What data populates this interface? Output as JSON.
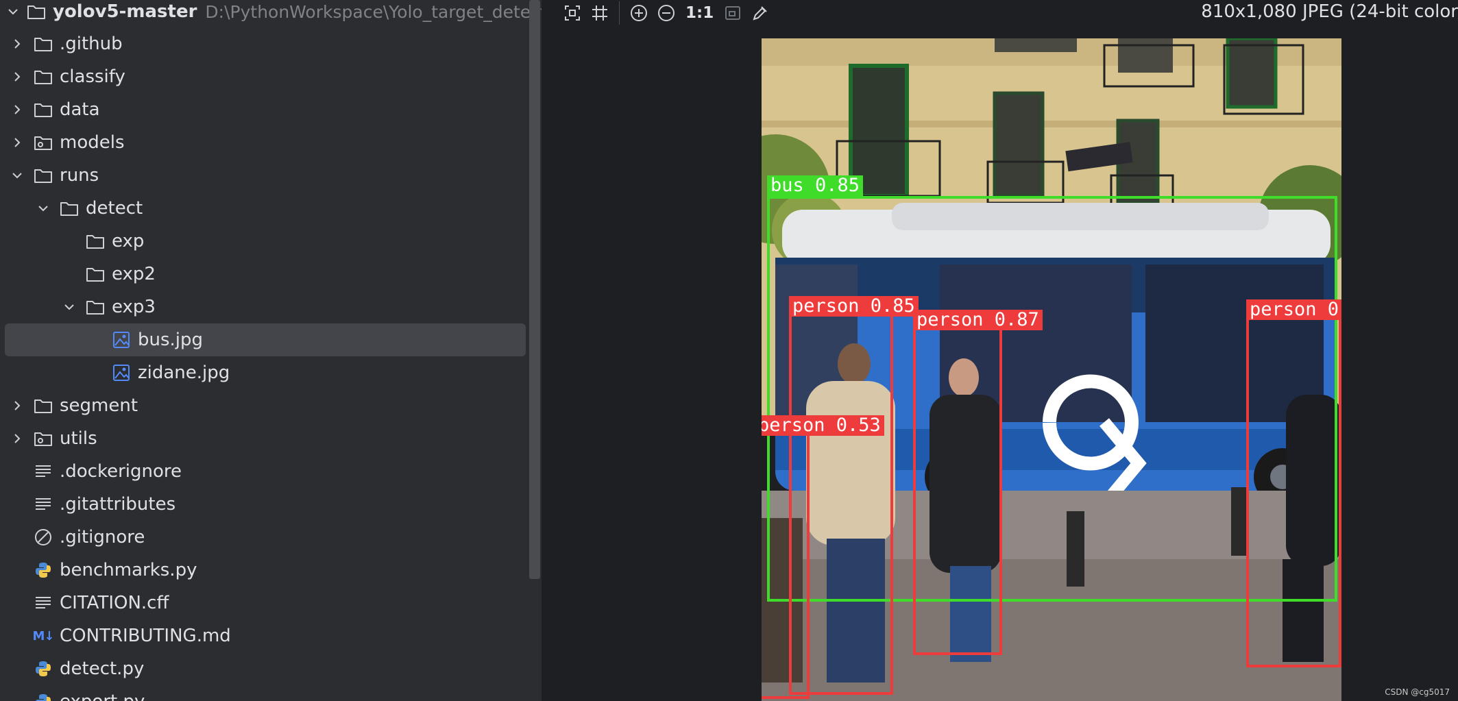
{
  "project_tree": {
    "root_name": "yolov5-master",
    "root_path": "D:\\PythonWorkspace\\Yolo_target_detect",
    "rows": [
      {
        "label": ".github",
        "depth": 1,
        "chevron": "right",
        "icon": "folder-icon"
      },
      {
        "label": "classify",
        "depth": 1,
        "chevron": "right",
        "icon": "folder-icon"
      },
      {
        "label": "data",
        "depth": 1,
        "chevron": "right",
        "icon": "folder-icon"
      },
      {
        "label": "models",
        "depth": 1,
        "chevron": "right",
        "icon": "package-folder-icon"
      },
      {
        "label": "runs",
        "depth": 1,
        "chevron": "down",
        "icon": "folder-icon"
      },
      {
        "label": "detect",
        "depth": 2,
        "chevron": "down",
        "icon": "folder-icon"
      },
      {
        "label": "exp",
        "depth": 3,
        "chevron": "none",
        "icon": "folder-icon"
      },
      {
        "label": "exp2",
        "depth": 3,
        "chevron": "none",
        "icon": "folder-icon"
      },
      {
        "label": "exp3",
        "depth": 3,
        "chevron": "down",
        "icon": "folder-icon"
      },
      {
        "label": "bus.jpg",
        "depth": 4,
        "chevron": "none",
        "icon": "image-file-icon",
        "selected": true
      },
      {
        "label": "zidane.jpg",
        "depth": 4,
        "chevron": "none",
        "icon": "image-file-icon"
      },
      {
        "label": "segment",
        "depth": 1,
        "chevron": "right",
        "icon": "folder-icon"
      },
      {
        "label": "utils",
        "depth": 1,
        "chevron": "right",
        "icon": "package-folder-icon"
      },
      {
        "label": ".dockerignore",
        "depth": 1,
        "chevron": "none",
        "icon": "text-file-icon"
      },
      {
        "label": ".gitattributes",
        "depth": 1,
        "chevron": "none",
        "icon": "text-file-icon"
      },
      {
        "label": ".gitignore",
        "depth": 1,
        "chevron": "none",
        "icon": "ignore-file-icon"
      },
      {
        "label": "benchmarks.py",
        "depth": 1,
        "chevron": "none",
        "icon": "python-file-icon"
      },
      {
        "label": "CITATION.cff",
        "depth": 1,
        "chevron": "none",
        "icon": "text-file-icon"
      },
      {
        "label": "CONTRIBUTING.md",
        "depth": 1,
        "chevron": "none",
        "icon": "markdown-file-icon"
      },
      {
        "label": "detect.py",
        "depth": 1,
        "chevron": "none",
        "icon": "python-file-icon"
      },
      {
        "label": "export.py",
        "depth": 1,
        "chevron": "none",
        "icon": "python-file-icon"
      }
    ]
  },
  "viewer": {
    "toolbar": {
      "buttons": [
        "fit-screen-icon",
        "grid-icon",
        "zoom-in-icon",
        "zoom-out-icon"
      ],
      "actual_size_label": "1:1",
      "more_buttons": [
        "fit-window-icon",
        "color-picker-icon"
      ]
    },
    "image_info": "810x1,080 JPEG (24-bit color",
    "detections": [
      {
        "label": "bus 0.85",
        "color": "#3fdc2a"
      },
      {
        "label": "person 0.85",
        "color": "#ee3b3b"
      },
      {
        "label": "person 0.87",
        "color": "#ee3b3b"
      },
      {
        "label": "person 0",
        "color": "#ee3b3b"
      },
      {
        "label": "person 0.53",
        "color": "#ee3b3b"
      }
    ],
    "watermark": "CSDN @cg5017"
  },
  "colors": {
    "panel_bg": "#2b2d30",
    "viewer_bg": "#1e1f22",
    "selection": "#43454a",
    "folder_stroke": "#ced0d6",
    "image_icon": "#548af7"
  }
}
